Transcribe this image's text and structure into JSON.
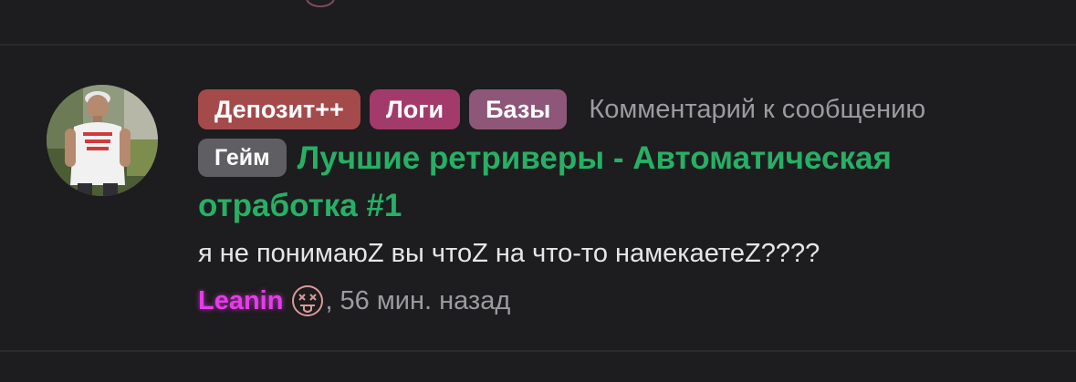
{
  "post": {
    "tags": [
      {
        "label": "Депозит++",
        "color": "#a44a4b"
      },
      {
        "label": "Логи",
        "color": "#a23b6b"
      },
      {
        "label": "Базы",
        "color": "#8e5678"
      }
    ],
    "comment_label": "Комментарий к сообщению",
    "game_tag": {
      "label": "Гейм",
      "color": "#5f5f63"
    },
    "thread_title": "Лучшие ретриверы - Автоматическая отработка #1",
    "message": "я не понимаюZ вы чтоZ на что-то намекаетеZ????",
    "author": {
      "name": "Leanin",
      "color": "#e73bea",
      "status_icon": "dizzy-tongue-face-icon"
    },
    "separator": ",",
    "time": "56 мин. назад"
  },
  "colors": {
    "background": "#1d1c1e",
    "title": "#27b065",
    "muted": "#9c9b9f",
    "text": "#e6e5e8"
  }
}
